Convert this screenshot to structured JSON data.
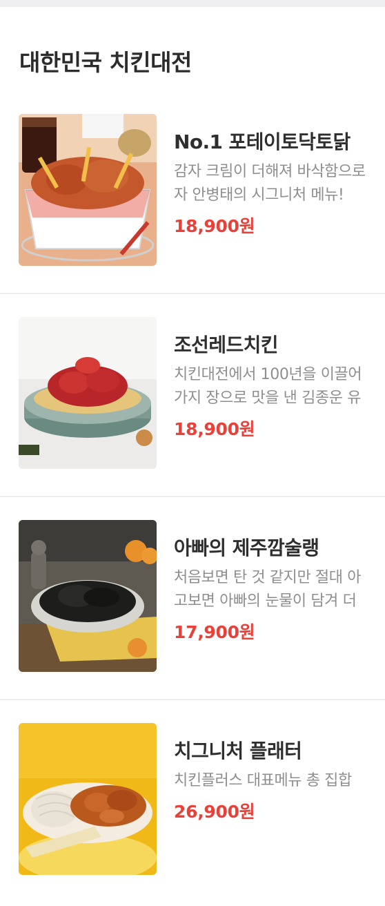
{
  "section": {
    "title": "대한민국 치킨대전"
  },
  "menu_items": [
    {
      "name": "No.1 포테이토닥토닭",
      "desc_line1": "감자 크림이 더해져 바삭함으로",
      "desc_line2": "자 안병태의 시그니처 메뉴!",
      "price": "18,900원",
      "image_icon": "fried-chicken-fries-basket"
    },
    {
      "name": "조선레드치킨",
      "desc_line1": "치킨대전에서 100년을 이끌어",
      "desc_line2": "가지 장으로 맛을 낸 김종운 유",
      "price": "18,900원",
      "image_icon": "red-sauce-chicken-platter"
    },
    {
      "name": "아빠의 제주깜술랭",
      "desc_line1": "처음보면 탄 것 같지만 절대 아",
      "desc_line2": "고보면 아빠의 눈물이 담겨 더",
      "price": "17,900원",
      "image_icon": "black-chicken-tangerine-plate"
    },
    {
      "name": "치그니처 플래터",
      "desc_line1": "치킨플러스 대표메뉴 총 집합",
      "desc_line2": "",
      "price": "26,900원",
      "image_icon": "chicken-platter-noodles"
    }
  ],
  "colors": {
    "price": "#e8413a",
    "title": "#2b2b2b",
    "description": "#8e8e8e",
    "divider": "#ececec",
    "top_strip": "#efeff2"
  }
}
